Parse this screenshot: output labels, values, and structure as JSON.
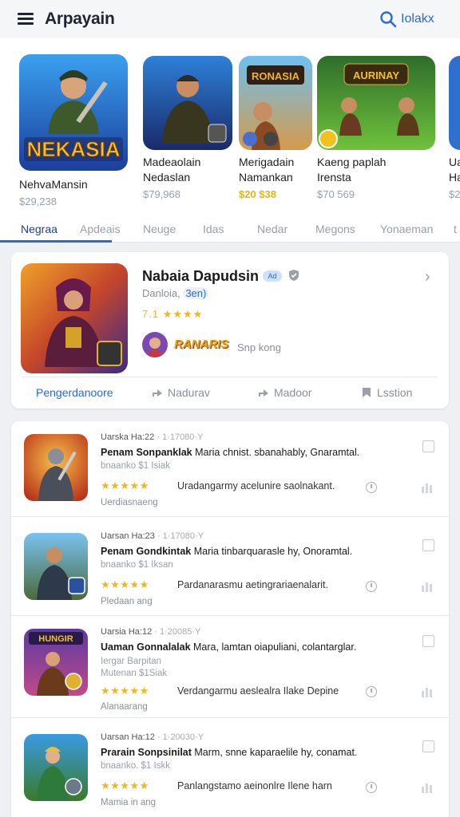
{
  "header": {
    "title": "Arpayain",
    "search_label": "Iolakx",
    "menu_icon": "hamburger-menu-icon",
    "search_icon": "search-icon",
    "accent": "#2a6ad8"
  },
  "featured": [
    {
      "name": "NehvaMansin",
      "price": "$29,238",
      "logo_text": "NEKASIA",
      "gold": false
    },
    {
      "name": "Madeaolain\nNedaslan",
      "price": "$79,968",
      "gold": false
    },
    {
      "name": "Merigadain\nNamankan",
      "price": "$20 $38",
      "logo_text": "RONASIA",
      "gold": true
    },
    {
      "name": "Kaeng paplah\nIrensta",
      "price": "$70 569",
      "logo_text": "AURINAY",
      "gold": false
    },
    {
      "name": "Ua\nHa",
      "price": "$2",
      "gold": false
    }
  ],
  "tabs": [
    "Negraa",
    "Apdeais",
    "Neuge",
    "Idas",
    "Nedar",
    "Megons",
    "Yonaeman",
    "t"
  ],
  "hero": {
    "title": "Nabaia Dapudsin",
    "badge": "Ad",
    "subtitle": "Danloia,",
    "subtitle_tag": "3en)",
    "rating": "7.1",
    "stars": "★★★★",
    "logo": "RANARIS",
    "logo_sub": "Snp kong",
    "actions": [
      "Pengerdanoore",
      "Nadurav",
      "Madoor",
      "Lsstion"
    ]
  },
  "list": [
    {
      "meta": "Uarska Ha:22",
      "meta_dim": "· 1·17080·Y",
      "title_bold": "Penam Sonpanklak",
      "title_rest": " Maria  chnist. sbanahably, Gnaramtal.",
      "desc": "bnaanko  $1 Isiak",
      "stars": "★★★★★",
      "review": "Uradangarmy acelunire saolnakant.",
      "category": "Uerdiasnaeng",
      "logo_text": ""
    },
    {
      "meta": "Uarsan Ha:23",
      "meta_dim": "· 1·17080·Y",
      "title_bold": "Penam Gondkintak",
      "title_rest": " Maria  tinbarquarasle hy, Onoramtal.",
      "desc": "bnaanko  $1 Iksan",
      "stars": "★★★★★",
      "review": "Pardanarasmu aetingrariaenalarit.",
      "category": "Pledaan ang",
      "logo_text": ""
    },
    {
      "meta": "Uarsia Ha:12",
      "meta_dim": "· 1·20085·Y",
      "title_bold": "Uaman Gonnalalak",
      "title_rest": " Mara,  lamtan oiapuliani, colantarglar.",
      "desc": "Iergar Barpitan\nMutenan $1Siak",
      "stars": "★★★★★",
      "review": "Verdangarmu aeslealra  Ilake Depine",
      "category": "Alanaarang",
      "logo_text": "HUNGIR"
    },
    {
      "meta": "Uarsan Ha:12",
      "meta_dim": "· 1·20030·Y",
      "title_bold": "Prarain Sonpsinilat",
      "title_rest": " Marm,  snne kaparaelile hy, conamat.",
      "desc": "bnaanko.  $1 Iskk",
      "stars": "★★★★★",
      "review": "Panlangstamo aeinonlre  Ilene harn",
      "category": "Mamia in ang",
      "logo_text": ""
    }
  ]
}
